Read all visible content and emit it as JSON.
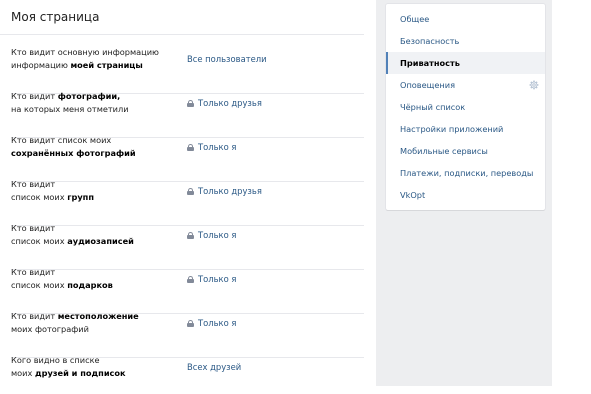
{
  "page": {
    "title": "Моя страница"
  },
  "settings": [
    {
      "text_plain": "Кто видит основную информацию",
      "text_bold": "моей страницы",
      "value": "Все пользователи",
      "locked": false
    },
    {
      "text_plain": "Кто видит",
      "text_bold": "фотографии,",
      "text_after": "на которых меня отметили",
      "value": "Только друзья",
      "locked": true
    },
    {
      "text_plain": "Кто видит список моих",
      "text_bold": "сохранённых фотографий",
      "value": "Только я",
      "locked": true
    },
    {
      "text_plain": "Кто видит список моих",
      "text_bold": "групп",
      "value": "Только друзья",
      "locked": true
    },
    {
      "text_plain": "Кто видит список моих",
      "text_bold": "аудиозаписей",
      "value": "Только я",
      "locked": true
    },
    {
      "text_plain": "Кто видит список моих",
      "text_bold": "подарков",
      "value": "Только я",
      "locked": true
    },
    {
      "text_plain": "Кто видит",
      "text_bold": "местоположение",
      "text_after": "моих фотографий",
      "value": "Только я",
      "locked": true
    },
    {
      "text_plain": "Кого видно в списке моих",
      "text_bold": "друзей и подписок",
      "value": "Всех друзей",
      "locked": false
    }
  ],
  "menu": {
    "items": [
      {
        "label": "Общее",
        "active": false
      },
      {
        "label": "Безопасность",
        "active": false
      },
      {
        "label": "Приватность",
        "active": true
      },
      {
        "label": "Оповещения",
        "active": false,
        "icon": "gear-icon"
      },
      {
        "label": "Чёрный список",
        "active": false
      },
      {
        "label": "Настройки приложений",
        "active": false
      },
      {
        "label": "Мобильные сервисы",
        "active": false
      },
      {
        "label": "Платежи, подписки, переводы",
        "active": false
      },
      {
        "label": "VkOpt",
        "active": false
      }
    ]
  },
  "colors": {
    "link": "#2a5885",
    "side_background": "#edeef0",
    "active_marker": "#5181b8",
    "lock_icon": "#828a99"
  }
}
